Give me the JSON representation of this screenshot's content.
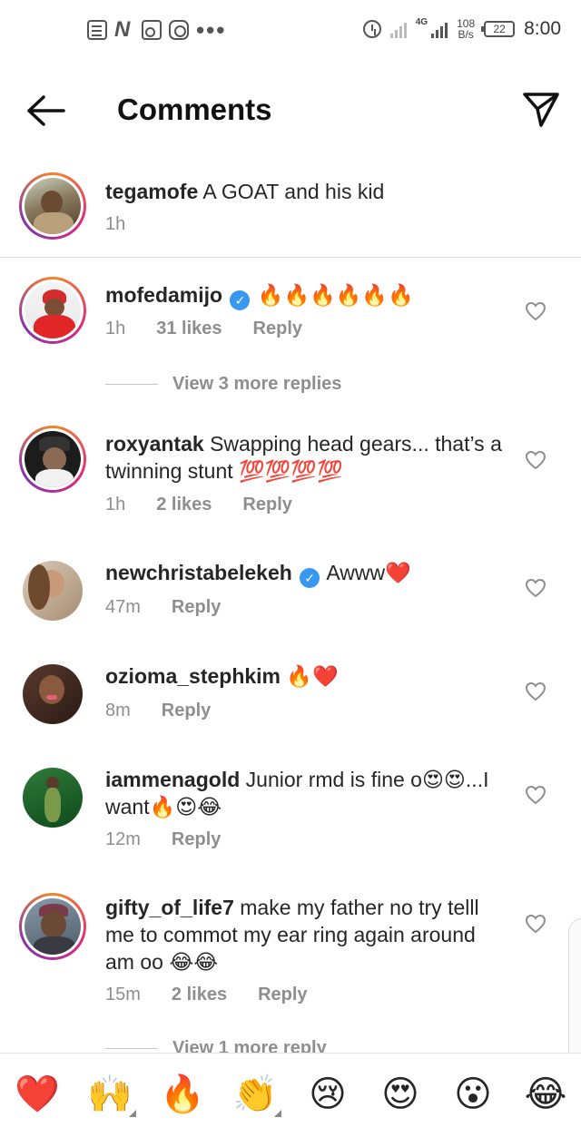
{
  "status_bar": {
    "network": "4G",
    "speed_value": "108",
    "speed_unit": "B/s",
    "battery": "22",
    "time": "8:00",
    "notification_icons": [
      "doc-icon",
      "n-icon",
      "radio-icon",
      "instagram-icon",
      "more-dots-icon"
    ],
    "more_dots": "•••"
  },
  "header": {
    "title": "Comments"
  },
  "caption": {
    "username": "tegamofe",
    "text": "A GOAT and his kid",
    "time": "1h"
  },
  "comments": [
    {
      "username": "mofedamijo",
      "verified": true,
      "text": "🔥🔥🔥🔥🔥🔥",
      "time": "1h",
      "likes": "31 likes",
      "reply": "Reply",
      "view_more": "View 3 more replies"
    },
    {
      "username": "roxyantak",
      "verified": false,
      "text": "Swapping head gears... that’s a twinning stunt 💯💯💯💯",
      "time": "1h",
      "likes": "2 likes",
      "reply": "Reply"
    },
    {
      "username": "newchristabelekeh",
      "verified": true,
      "text": "Awww❤️",
      "time": "47m",
      "reply": "Reply"
    },
    {
      "username": "ozioma_stephkim",
      "verified": false,
      "text": "🔥❤️",
      "time": "8m",
      "reply": "Reply"
    },
    {
      "username": "iammenagold",
      "verified": false,
      "text": "Junior rmd is fine o😍😍...I want🔥😍😂",
      "time": "12m",
      "reply": "Reply"
    },
    {
      "username": "gifty_of_life7",
      "verified": false,
      "text": "make my father no try telll me to commot my ear ring again around am oo 😂😂",
      "time": "15m",
      "likes": "2 likes",
      "reply": "Reply",
      "view_more": "View 1 more reply"
    }
  ],
  "verified_check": "✓",
  "emoji_bar": [
    "❤️",
    "🙌",
    "🔥",
    "👏",
    "😢",
    "😍",
    "😮",
    "😂"
  ],
  "colors": {
    "text": "#262626",
    "secondary": "#8e8e8e",
    "verified": "#3897f0",
    "story_ring": "#dd2a7b"
  }
}
